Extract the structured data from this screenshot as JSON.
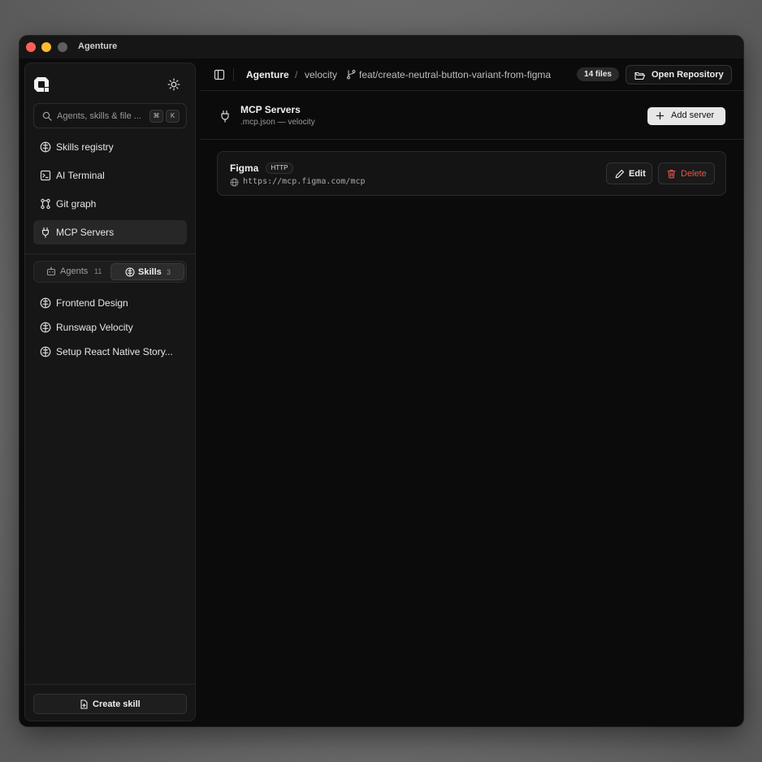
{
  "window": {
    "title": "Agenture"
  },
  "sidebar": {
    "logo_icon": "agenture-logo-icon",
    "theme_icon": "sun-icon",
    "search": {
      "placeholder": "Agents, skills & file ...",
      "shortcut_mod": "⌘",
      "shortcut_key": "K"
    },
    "nav": [
      {
        "label": "Skills registry",
        "icon": "brain-icon"
      },
      {
        "label": "AI Terminal",
        "icon": "terminal-icon"
      },
      {
        "label": "Git graph",
        "icon": "git-graph-icon"
      },
      {
        "label": "MCP Servers",
        "icon": "plug-icon",
        "active": true
      }
    ],
    "segments": [
      {
        "label": "Agents",
        "count": "11",
        "icon": "bot-icon",
        "active": false
      },
      {
        "label": "Skills",
        "count": "3",
        "icon": "brain-icon",
        "active": true
      }
    ],
    "skills": [
      {
        "label": "Frontend Design"
      },
      {
        "label": "Runswap Velocity"
      },
      {
        "label": "Setup React Native Story..."
      }
    ],
    "create_button": "Create skill"
  },
  "topbar": {
    "breadcrumb": {
      "app": "Agenture",
      "separator": "/",
      "repo": "velocity",
      "branch": "feat/create-neutral-button-variant-from-figma"
    },
    "files_badge": "14 files",
    "open_repo_label": "Open Repository"
  },
  "page": {
    "title": "MCP Servers",
    "subtitle": ".mcp.json — velocity",
    "add_button": "Add server"
  },
  "servers": [
    {
      "name": "Figma",
      "transport": "HTTP",
      "url": "https://mcp.figma.com/mcp",
      "edit_label": "Edit",
      "delete_label": "Delete"
    }
  ],
  "colors": {
    "danger": "#e5554a",
    "background": "#0b0b0b",
    "sidebar": "#161616",
    "primary_button": "#e7e7e7"
  }
}
